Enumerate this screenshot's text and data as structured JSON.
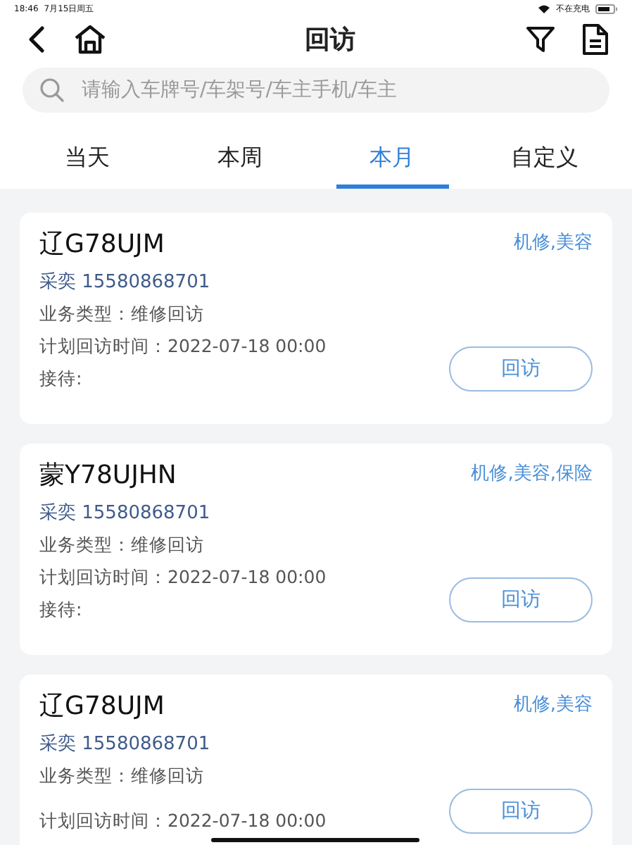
{
  "status_bar": {
    "time": "18:46",
    "date": "7月15日周五",
    "charging": "不在充电"
  },
  "header": {
    "title": "回访"
  },
  "search": {
    "placeholder": "请输入车牌号/车架号/车主手机/车主"
  },
  "tabs": [
    {
      "label": "当天",
      "selected": false
    },
    {
      "label": "本周",
      "selected": false
    },
    {
      "label": "本月",
      "selected": true
    },
    {
      "label": "自定义",
      "selected": false
    }
  ],
  "cards": [
    {
      "plate": "辽G78UJM",
      "tags": "机修,美容",
      "customer": "采奕 15580868701",
      "business_type": "业务类型：维修回访",
      "planned_time": "计划回访时间：2022-07-18 00:00",
      "reception": "接待:",
      "button": "回访"
    },
    {
      "plate": "蒙Y78UJHN",
      "tags": "机修,美容,保险",
      "customer": "采奕 15580868701",
      "business_type": "业务类型：维修回访",
      "planned_time": "计划回访时间：2022-07-18 00:00",
      "reception": "接待:",
      "button": "回访"
    },
    {
      "plate": "辽G78UJM",
      "tags": "机修,美容",
      "customer": "采奕 15580868701",
      "business_type": "业务类型：维修回访",
      "planned_time": "计划回访时间：2022-07-18 00:00",
      "button": "回访"
    }
  ]
}
